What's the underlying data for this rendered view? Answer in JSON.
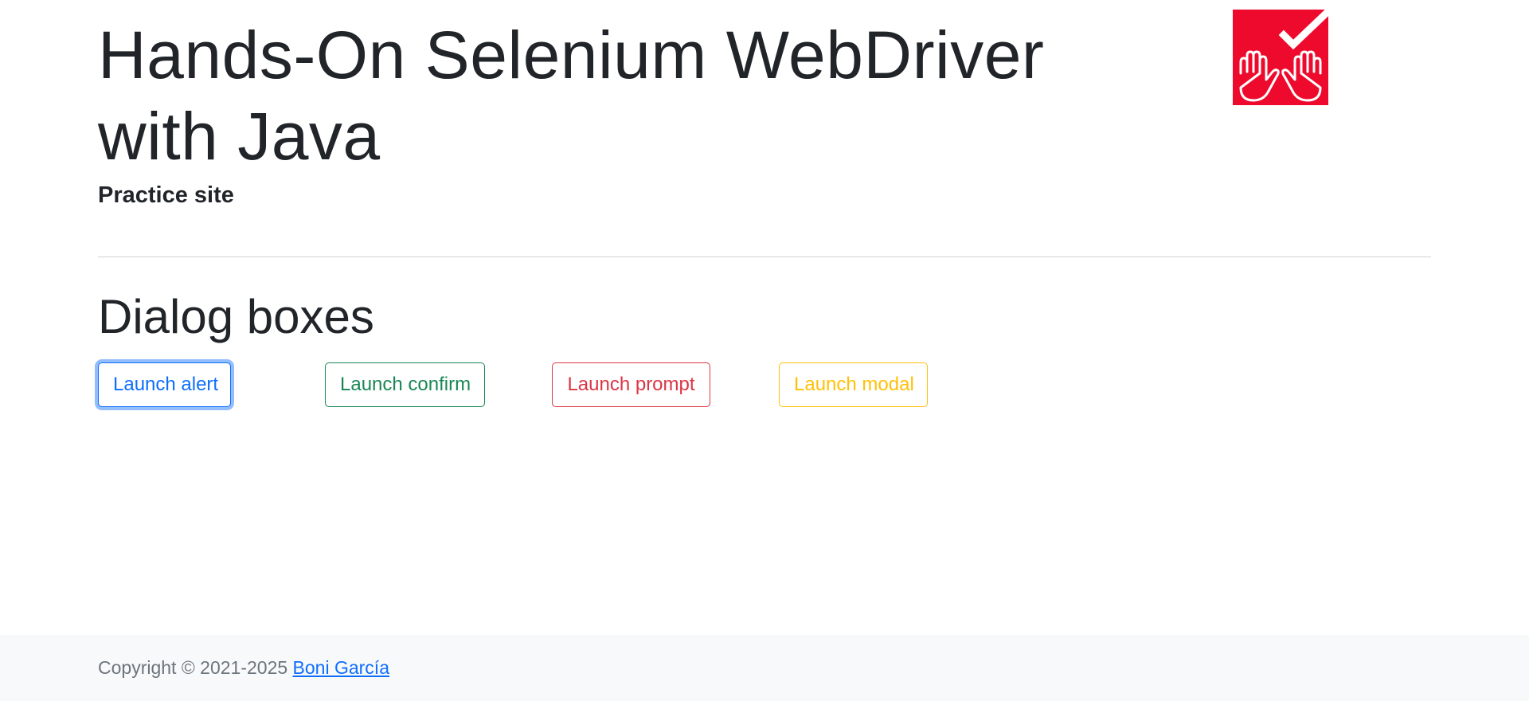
{
  "header": {
    "title": "Hands-On Selenium WebDriver with Java",
    "subtitle": "Practice site",
    "logo_colors": {
      "background": "#ee0a2c",
      "foreground": "#ffffff"
    }
  },
  "section": {
    "title": "Dialog boxes"
  },
  "buttons": {
    "alert": {
      "label": "Launch alert",
      "color": "#0d6efd"
    },
    "confirm": {
      "label": "Launch confirm",
      "color": "#198754"
    },
    "prompt": {
      "label": "Launch prompt",
      "color": "#dc3545"
    },
    "modal": {
      "label": "Launch modal",
      "color": "#ffc107"
    }
  },
  "footer": {
    "copyright": "Copyright © 2021-2025",
    "author_link": "Boni García"
  }
}
